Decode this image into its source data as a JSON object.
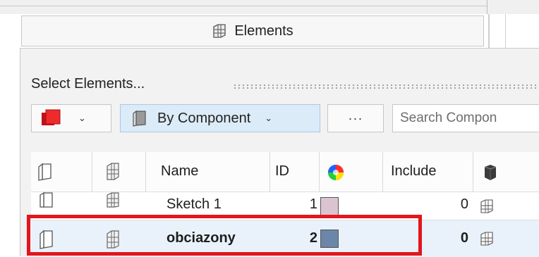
{
  "panel": {
    "tab_label": "Elements",
    "select_label": "Select Elements...",
    "color_button_color": "#e21b1b",
    "by_component_label": "By Component",
    "more_label": "···",
    "search_placeholder": "Search Compon"
  },
  "table": {
    "columns": [
      "",
      "",
      "Name",
      "ID",
      "",
      "Include",
      ""
    ],
    "rows": [
      {
        "name": "Sketch 1",
        "id": "1",
        "color": "#dcc3d2",
        "include": "0",
        "selected": false
      },
      {
        "name": "obciazony",
        "id": "2",
        "color": "#6b86a8",
        "include": "0",
        "selected": true
      }
    ]
  },
  "icons": [
    "elements-icon",
    "component-icon",
    "color-wheel-icon",
    "solid-part-icon",
    "mesh-icon",
    "chevron-down-icon"
  ]
}
